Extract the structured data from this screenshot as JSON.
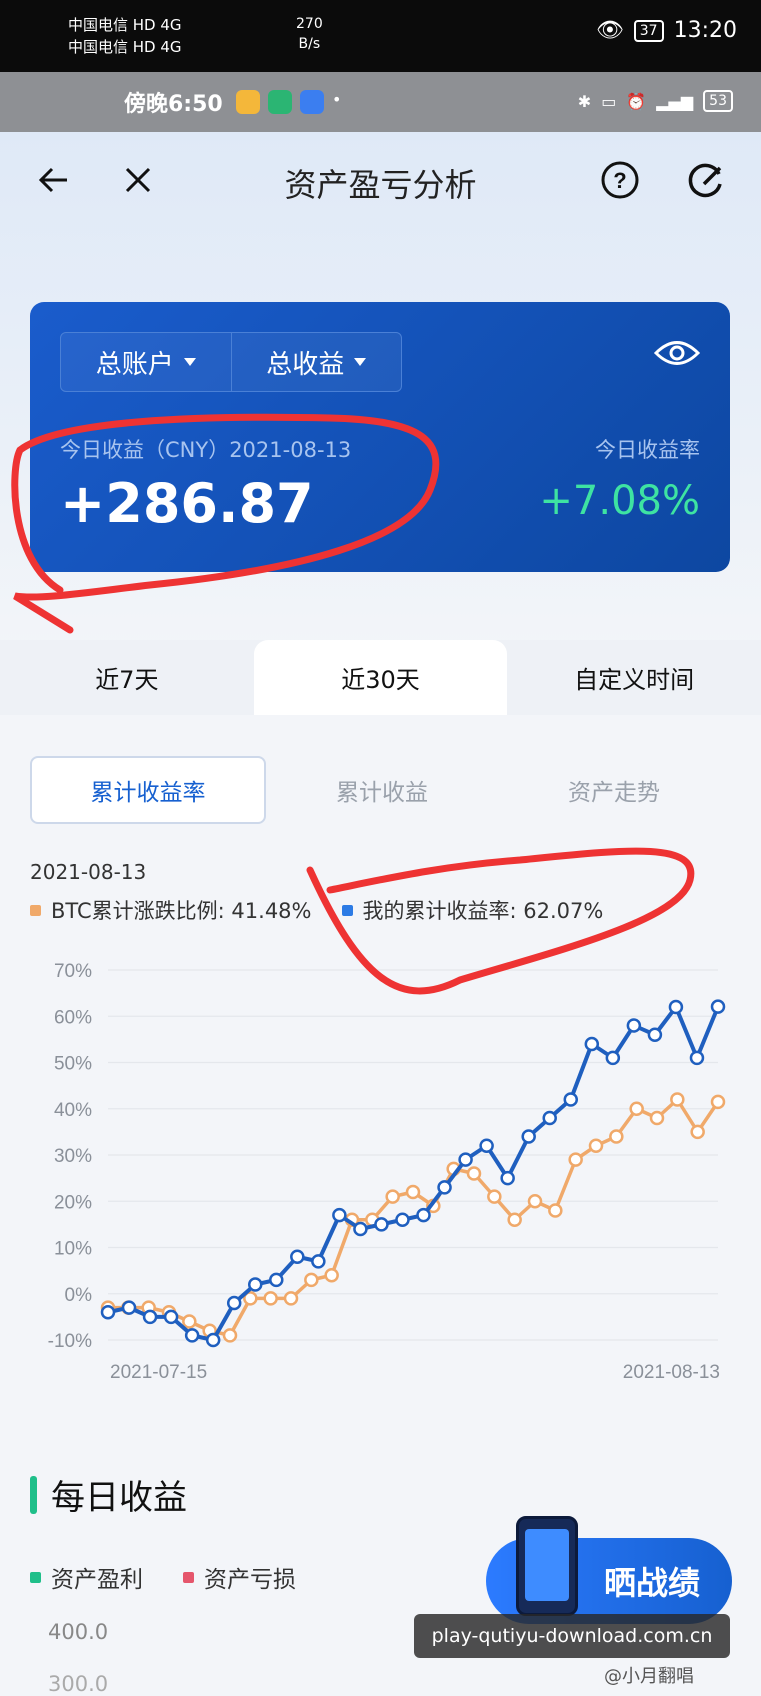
{
  "status_bar": {
    "carrier_line1": "中国电信 HD 4G",
    "carrier_line2": "中国电信 HD 4G",
    "speed_value": "270",
    "speed_unit": "B/s",
    "battery": "37",
    "time": "13:20"
  },
  "notif_bar": {
    "time": "傍晚6:50",
    "battery": "53"
  },
  "nav": {
    "title": "资产盈亏分析",
    "back_icon": "arrow-left-icon",
    "close_icon": "close-icon",
    "help_icon": "question-icon",
    "refresh_icon": "refresh-icon"
  },
  "summary": {
    "account_label": "总账户",
    "profit_label": "总收益",
    "today_label": "今日收益（CNY）2021-08-13",
    "today_value": "+286.87",
    "rate_label": "今日收益率",
    "rate_value": "+7.08%"
  },
  "range_tabs": [
    "近7天",
    "近30天",
    "自定义时间"
  ],
  "metric_tabs": [
    "累计收益率",
    "累计收益",
    "资产走势"
  ],
  "chart_header": {
    "date": "2021-08-13",
    "btc_legend": "BTC累计涨跌比例: 41.48%",
    "my_legend": "我的累计收益率: 62.07%"
  },
  "colors": {
    "btc": "#f0a96a",
    "mine": "#1f5fbf",
    "profit": "#1fbf8a",
    "loss": "#e5566c",
    "accent": "#1660d0"
  },
  "chart_data": {
    "type": "line",
    "x_start_label": "2021-07-15",
    "x_end_label": "2021-08-13",
    "y_ticks": [
      "70%",
      "60%",
      "50%",
      "40%",
      "30%",
      "20%",
      "10%",
      "0%",
      "-10%"
    ],
    "ylim": [
      -10,
      70
    ],
    "series": [
      {
        "name": "BTC累计涨跌比例",
        "values": [
          -3,
          -3,
          -3,
          -4,
          -6,
          -8,
          -9,
          -1,
          -1,
          -1,
          3,
          4,
          16,
          16,
          21,
          22,
          19,
          27,
          26,
          21,
          16,
          20,
          18,
          29,
          32,
          34,
          40,
          38,
          42,
          35,
          41.48
        ]
      },
      {
        "name": "我的累计收益率",
        "values": [
          -4,
          -3,
          -5,
          -5,
          -9,
          -10,
          -2,
          2,
          3,
          8,
          7,
          17,
          14,
          15,
          16,
          17,
          23,
          29,
          32,
          25,
          34,
          38,
          42,
          54,
          51,
          58,
          56,
          62,
          51,
          62.07
        ]
      }
    ]
  },
  "daily": {
    "title": "每日收益",
    "profit_label": "资产盈利",
    "loss_label": "资产亏损",
    "y_top": "400.0",
    "y_next": "300.0"
  },
  "share": {
    "label": "晒战绩"
  },
  "watermark": {
    "site": "play-qutiyu-download.com.cn",
    "author": "@小月翻唱"
  }
}
